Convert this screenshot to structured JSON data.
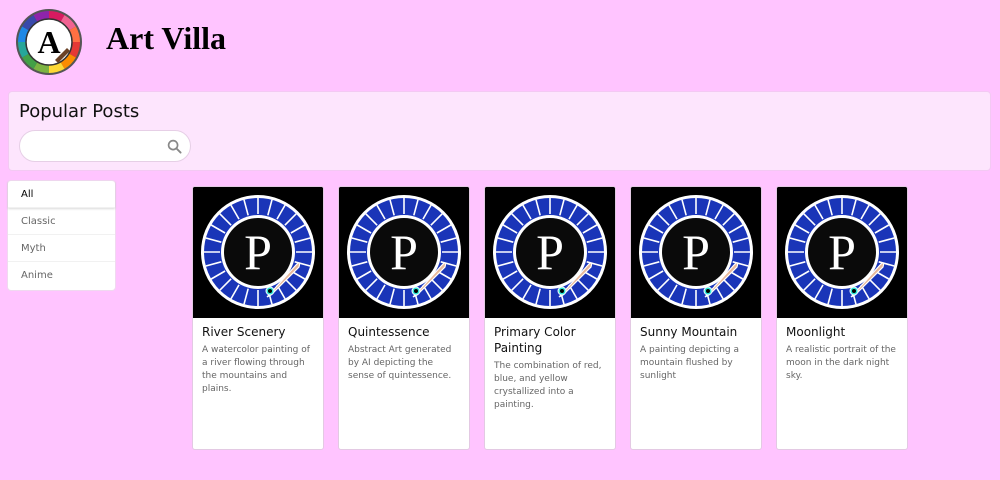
{
  "header": {
    "title": "Art Villa",
    "logo_letter": "A"
  },
  "panel": {
    "title": "Popular Posts",
    "search": {
      "placeholder": "",
      "value": ""
    }
  },
  "filters": [
    {
      "label": "All",
      "active": true
    },
    {
      "label": "Classic",
      "active": false
    },
    {
      "label": "Myth",
      "active": false
    },
    {
      "label": "Anime",
      "active": false
    }
  ],
  "posts": [
    {
      "title": "River Scenery",
      "description": "A watercolor painting of a river flowing through the mountains and plains.",
      "image_letter": "P"
    },
    {
      "title": "Quintessence",
      "description": "Abstract Art generated by AI depicting the sense of quintessence.",
      "image_letter": "P"
    },
    {
      "title": "Primary Color Painting",
      "description": "The combination of red, blue, and yellow crystallized into a painting.",
      "image_letter": "P"
    },
    {
      "title": "Sunny Mountain",
      "description": "A painting depicting a mountain flushed by sunlight",
      "image_letter": "P"
    },
    {
      "title": "Moonlight",
      "description": "A realistic portrait of the moon in the dark night sky.",
      "image_letter": "P"
    }
  ],
  "colors": {
    "background": "#ffc4ff",
    "panel": "#fde5fd",
    "card_image_bg": "#000000",
    "ring_blue": "#1a35b8",
    "brush": "#e8b89a",
    "brush_tip": "#2ee6d6"
  },
  "icons": {
    "search": "search-icon",
    "logo": "palette-logo-icon",
    "post_image": "paint-brush-logo-icon"
  }
}
